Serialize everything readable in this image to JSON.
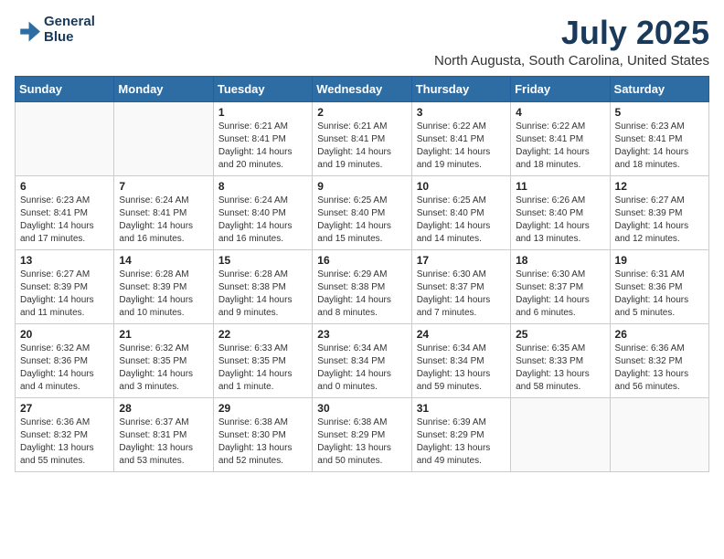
{
  "header": {
    "logo_line1": "General",
    "logo_line2": "Blue",
    "month_title": "July 2025",
    "location": "North Augusta, South Carolina, United States"
  },
  "days_of_week": [
    "Sunday",
    "Monday",
    "Tuesday",
    "Wednesday",
    "Thursday",
    "Friday",
    "Saturday"
  ],
  "weeks": [
    [
      {
        "day": "",
        "sunrise": "",
        "sunset": "",
        "daylight": ""
      },
      {
        "day": "",
        "sunrise": "",
        "sunset": "",
        "daylight": ""
      },
      {
        "day": "1",
        "sunrise": "Sunrise: 6:21 AM",
        "sunset": "Sunset: 8:41 PM",
        "daylight": "Daylight: 14 hours and 20 minutes."
      },
      {
        "day": "2",
        "sunrise": "Sunrise: 6:21 AM",
        "sunset": "Sunset: 8:41 PM",
        "daylight": "Daylight: 14 hours and 19 minutes."
      },
      {
        "day": "3",
        "sunrise": "Sunrise: 6:22 AM",
        "sunset": "Sunset: 8:41 PM",
        "daylight": "Daylight: 14 hours and 19 minutes."
      },
      {
        "day": "4",
        "sunrise": "Sunrise: 6:22 AM",
        "sunset": "Sunset: 8:41 PM",
        "daylight": "Daylight: 14 hours and 18 minutes."
      },
      {
        "day": "5",
        "sunrise": "Sunrise: 6:23 AM",
        "sunset": "Sunset: 8:41 PM",
        "daylight": "Daylight: 14 hours and 18 minutes."
      }
    ],
    [
      {
        "day": "6",
        "sunrise": "Sunrise: 6:23 AM",
        "sunset": "Sunset: 8:41 PM",
        "daylight": "Daylight: 14 hours and 17 minutes."
      },
      {
        "day": "7",
        "sunrise": "Sunrise: 6:24 AM",
        "sunset": "Sunset: 8:41 PM",
        "daylight": "Daylight: 14 hours and 16 minutes."
      },
      {
        "day": "8",
        "sunrise": "Sunrise: 6:24 AM",
        "sunset": "Sunset: 8:40 PM",
        "daylight": "Daylight: 14 hours and 16 minutes."
      },
      {
        "day": "9",
        "sunrise": "Sunrise: 6:25 AM",
        "sunset": "Sunset: 8:40 PM",
        "daylight": "Daylight: 14 hours and 15 minutes."
      },
      {
        "day": "10",
        "sunrise": "Sunrise: 6:25 AM",
        "sunset": "Sunset: 8:40 PM",
        "daylight": "Daylight: 14 hours and 14 minutes."
      },
      {
        "day": "11",
        "sunrise": "Sunrise: 6:26 AM",
        "sunset": "Sunset: 8:40 PM",
        "daylight": "Daylight: 14 hours and 13 minutes."
      },
      {
        "day": "12",
        "sunrise": "Sunrise: 6:27 AM",
        "sunset": "Sunset: 8:39 PM",
        "daylight": "Daylight: 14 hours and 12 minutes."
      }
    ],
    [
      {
        "day": "13",
        "sunrise": "Sunrise: 6:27 AM",
        "sunset": "Sunset: 8:39 PM",
        "daylight": "Daylight: 14 hours and 11 minutes."
      },
      {
        "day": "14",
        "sunrise": "Sunrise: 6:28 AM",
        "sunset": "Sunset: 8:39 PM",
        "daylight": "Daylight: 14 hours and 10 minutes."
      },
      {
        "day": "15",
        "sunrise": "Sunrise: 6:28 AM",
        "sunset": "Sunset: 8:38 PM",
        "daylight": "Daylight: 14 hours and 9 minutes."
      },
      {
        "day": "16",
        "sunrise": "Sunrise: 6:29 AM",
        "sunset": "Sunset: 8:38 PM",
        "daylight": "Daylight: 14 hours and 8 minutes."
      },
      {
        "day": "17",
        "sunrise": "Sunrise: 6:30 AM",
        "sunset": "Sunset: 8:37 PM",
        "daylight": "Daylight: 14 hours and 7 minutes."
      },
      {
        "day": "18",
        "sunrise": "Sunrise: 6:30 AM",
        "sunset": "Sunset: 8:37 PM",
        "daylight": "Daylight: 14 hours and 6 minutes."
      },
      {
        "day": "19",
        "sunrise": "Sunrise: 6:31 AM",
        "sunset": "Sunset: 8:36 PM",
        "daylight": "Daylight: 14 hours and 5 minutes."
      }
    ],
    [
      {
        "day": "20",
        "sunrise": "Sunrise: 6:32 AM",
        "sunset": "Sunset: 8:36 PM",
        "daylight": "Daylight: 14 hours and 4 minutes."
      },
      {
        "day": "21",
        "sunrise": "Sunrise: 6:32 AM",
        "sunset": "Sunset: 8:35 PM",
        "daylight": "Daylight: 14 hours and 3 minutes."
      },
      {
        "day": "22",
        "sunrise": "Sunrise: 6:33 AM",
        "sunset": "Sunset: 8:35 PM",
        "daylight": "Daylight: 14 hours and 1 minute."
      },
      {
        "day": "23",
        "sunrise": "Sunrise: 6:34 AM",
        "sunset": "Sunset: 8:34 PM",
        "daylight": "Daylight: 14 hours and 0 minutes."
      },
      {
        "day": "24",
        "sunrise": "Sunrise: 6:34 AM",
        "sunset": "Sunset: 8:34 PM",
        "daylight": "Daylight: 13 hours and 59 minutes."
      },
      {
        "day": "25",
        "sunrise": "Sunrise: 6:35 AM",
        "sunset": "Sunset: 8:33 PM",
        "daylight": "Daylight: 13 hours and 58 minutes."
      },
      {
        "day": "26",
        "sunrise": "Sunrise: 6:36 AM",
        "sunset": "Sunset: 8:32 PM",
        "daylight": "Daylight: 13 hours and 56 minutes."
      }
    ],
    [
      {
        "day": "27",
        "sunrise": "Sunrise: 6:36 AM",
        "sunset": "Sunset: 8:32 PM",
        "daylight": "Daylight: 13 hours and 55 minutes."
      },
      {
        "day": "28",
        "sunrise": "Sunrise: 6:37 AM",
        "sunset": "Sunset: 8:31 PM",
        "daylight": "Daylight: 13 hours and 53 minutes."
      },
      {
        "day": "29",
        "sunrise": "Sunrise: 6:38 AM",
        "sunset": "Sunset: 8:30 PM",
        "daylight": "Daylight: 13 hours and 52 minutes."
      },
      {
        "day": "30",
        "sunrise": "Sunrise: 6:38 AM",
        "sunset": "Sunset: 8:29 PM",
        "daylight": "Daylight: 13 hours and 50 minutes."
      },
      {
        "day": "31",
        "sunrise": "Sunrise: 6:39 AM",
        "sunset": "Sunset: 8:29 PM",
        "daylight": "Daylight: 13 hours and 49 minutes."
      },
      {
        "day": "",
        "sunrise": "",
        "sunset": "",
        "daylight": ""
      },
      {
        "day": "",
        "sunrise": "",
        "sunset": "",
        "daylight": ""
      }
    ]
  ]
}
